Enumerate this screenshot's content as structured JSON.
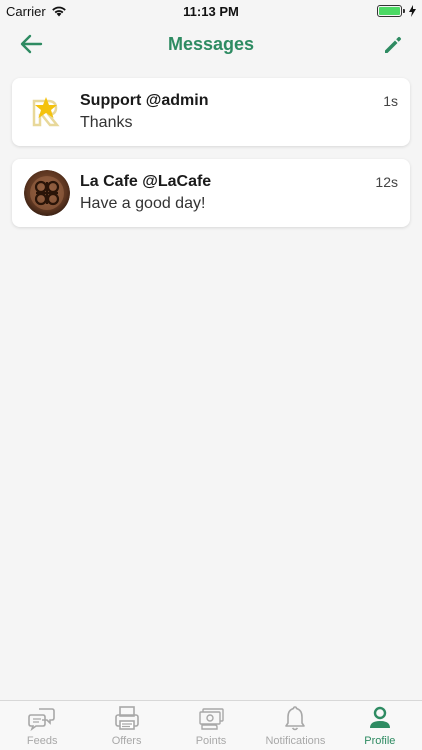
{
  "status_bar": {
    "carrier": "Carrier",
    "time": "11:13 PM"
  },
  "nav": {
    "title": "Messages",
    "back_icon": "arrow-left-icon",
    "edit_icon": "pencil-icon"
  },
  "messages": [
    {
      "name": "Support @admin",
      "text": "Thanks",
      "time": "1s",
      "avatar": "star-logo"
    },
    {
      "name": "La Cafe @LaCafe",
      "text": "Have a good day!",
      "time": "12s",
      "avatar": "cafe-photo"
    }
  ],
  "tabs": [
    {
      "label": "Feeds",
      "icon": "chat-bubbles-icon"
    },
    {
      "label": "Offers",
      "icon": "printer-icon"
    },
    {
      "label": "Points",
      "icon": "money-icon"
    },
    {
      "label": "Notifications",
      "icon": "bell-icon"
    },
    {
      "label": "Profile",
      "icon": "person-icon",
      "active": true
    }
  ],
  "colors": {
    "accent": "#2e8b62",
    "inactive_tab": "#a8a8a8",
    "background": "#f5f5f5"
  }
}
